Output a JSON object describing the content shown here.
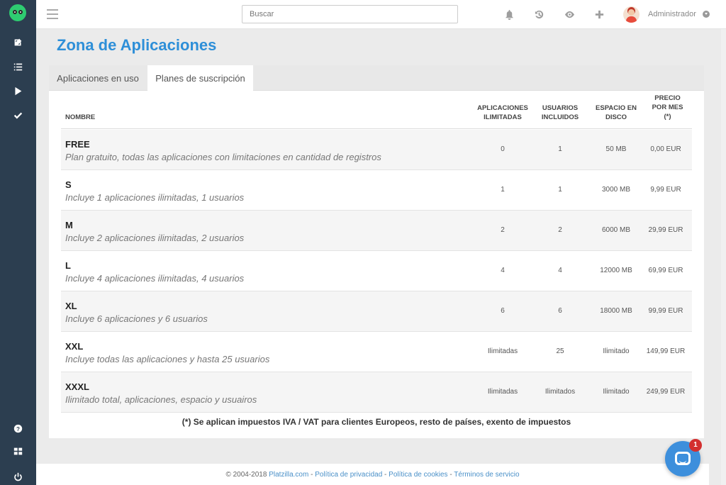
{
  "topbar": {
    "search_placeholder": "Buscar",
    "user_name": "Administrador",
    "icons": [
      "bell-icon",
      "history-icon",
      "eye-icon",
      "plus-icon"
    ]
  },
  "page": {
    "title": "Zona de Aplicaciones"
  },
  "tabs": [
    {
      "label": "Aplicaciones en uso",
      "active": false
    },
    {
      "label": "Planes de suscripción",
      "active": true
    }
  ],
  "table": {
    "headers": {
      "name": "NOMBRE",
      "apps": "APLICACIONES ILIMITADAS",
      "users": "USUARIOS INCLUIDOS",
      "disk": "ESPACIO EN DISCO",
      "price": "PRECIO POR MES (*)"
    },
    "rows": [
      {
        "name": "FREE",
        "desc": "Plan gratuito, todas las aplicaciones con limitaciones en cantidad de registros",
        "apps": "0",
        "users": "1",
        "disk": "50 MB",
        "price": "0,00 EUR"
      },
      {
        "name": "S",
        "desc": "Incluye 1 aplicaciones ilimitadas, 1 usuarios",
        "apps": "1",
        "users": "1",
        "disk": "3000 MB",
        "price": "9,99 EUR"
      },
      {
        "name": "M",
        "desc": "Incluye 2 aplicaciones ilimitadas, 2 usuarios",
        "apps": "2",
        "users": "2",
        "disk": "6000 MB",
        "price": "29,99 EUR"
      },
      {
        "name": "L",
        "desc": "Incluye 4 aplicaciones ilimitadas, 4 usuarios",
        "apps": "4",
        "users": "4",
        "disk": "12000 MB",
        "price": "69,99 EUR"
      },
      {
        "name": "XL",
        "desc": "Incluye 6 aplicaciones y 6 usuarios",
        "apps": "6",
        "users": "6",
        "disk": "18000 MB",
        "price": "99,99 EUR"
      },
      {
        "name": "XXL",
        "desc": "Incluye todas las aplicaciones y hasta 25 usuarios",
        "apps": "Ilimitadas",
        "users": "25",
        "disk": "Ilimitado",
        "price": "149,99 EUR"
      },
      {
        "name": "XXXL",
        "desc": "Ilimitado total, aplicaciones, espacio y usuairos",
        "apps": "Ilimitadas",
        "users": "Ilimitados",
        "disk": "Ilimitado",
        "price": "249,99 EUR"
      }
    ],
    "note": "(*) Se aplican impuestos IVA / VAT para clientes Europeos, resto de países, exento de impuestos"
  },
  "footer": {
    "copyright": "© 2004-2018",
    "brand": "Platzilla.com",
    "sep": " - ",
    "privacy": "Política de privacidad",
    "cookies": "Política de cookies",
    "terms": "Términos de servicio"
  },
  "chat": {
    "badge": "1"
  },
  "colors": {
    "sidebar": "#2c3e50",
    "accent": "#2e8fd8",
    "chat": "#3d8fdc",
    "badge": "#d32f2f"
  }
}
